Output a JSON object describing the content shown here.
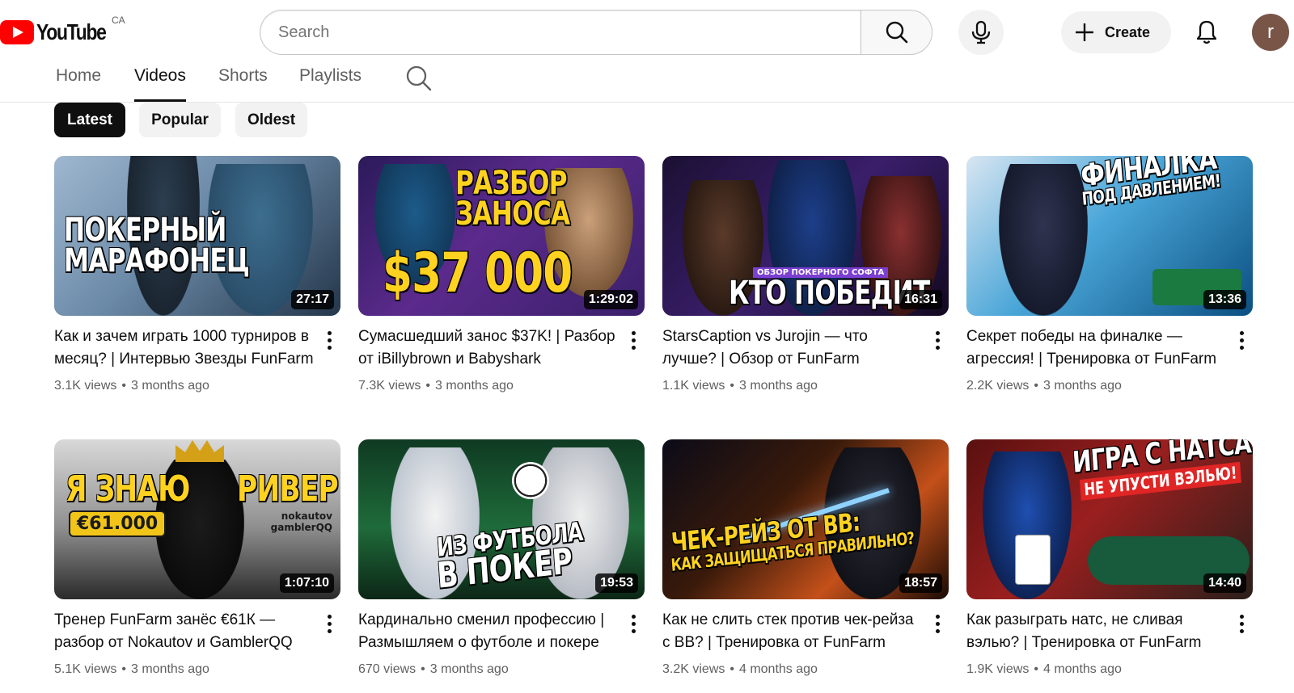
{
  "masthead": {
    "logo_text": "YouTube",
    "country_code": "CA",
    "search_placeholder": "Search",
    "create_label": "Create",
    "avatar_letter": "r",
    "avatar_color": "#795548"
  },
  "tabs": [
    {
      "label": "Home",
      "active": false
    },
    {
      "label": "Videos",
      "active": true
    },
    {
      "label": "Shorts",
      "active": false
    },
    {
      "label": "Playlists",
      "active": false
    }
  ],
  "chips": [
    {
      "label": "Latest",
      "active": true
    },
    {
      "label": "Popular",
      "active": false
    },
    {
      "label": "Oldest",
      "active": false
    }
  ],
  "videos": [
    {
      "title": "Как и зачем играть 1000 турниров в месяц? | Интервью Звезды FunFarm",
      "views": "3.1K views",
      "age": "3 months ago",
      "duration": "27:17",
      "thumb_text": [
        "ПОКЕРНЫЙ",
        "МАРАФОНЕЦ"
      ]
    },
    {
      "title": "Сумасшедший занос $37K! | Разбор от iBillybrown и Babyshark",
      "views": "7.3K views",
      "age": "3 months ago",
      "duration": "1:29:02",
      "thumb_text": [
        "РАЗБОР",
        "ЗАНОСА",
        "$37 000"
      ]
    },
    {
      "title": "StarsCaption vs Jurojin — что лучше? | Обзор от FunFarm",
      "views": "1.1K views",
      "age": "3 months ago",
      "duration": "16:31",
      "thumb_text": [
        "ОБЗОР ПОКЕРНОГО СОФТА",
        "КТО ПОБЕДИТ"
      ]
    },
    {
      "title": "Секрет победы на финалке — агрессия! | Тренировка от FunFarm",
      "views": "2.2K views",
      "age": "3 months ago",
      "duration": "13:36",
      "thumb_text": [
        "ФИНАЛКА",
        "ПОД ДАВЛЕНИЕМ!"
      ]
    },
    {
      "title": "Тренер FunFarm занёс €61К — разбор от Nokautov и GamblerQQ",
      "views": "5.1K views",
      "age": "3 months ago",
      "duration": "1:07:10",
      "thumb_text": [
        "Я ЗНАЮ",
        "РИВЕР",
        "€61.000",
        "nokautov",
        "gamblerQQ"
      ]
    },
    {
      "title": "Кардинально сменил профессию | Размышляем о футболе и покере",
      "views": "670 views",
      "age": "3 months ago",
      "duration": "19:53",
      "thumb_text": [
        "ИЗ ФУТБОЛА",
        "В ПОКЕР"
      ]
    },
    {
      "title": "Как не слить стек против чек-рейза с BB? | Тренировка от FunFarm",
      "views": "3.2K views",
      "age": "4 months ago",
      "duration": "18:57",
      "thumb_text": [
        "ЧЕК-РЕЙЗ ОТ BB:",
        "КАК ЗАЩИЩАТЬСЯ ПРАВИЛЬНО?"
      ]
    },
    {
      "title": "Как разыграть натс, не сливая вэлью? | Тренировка от FunFarm",
      "views": "1.9K views",
      "age": "4 months ago",
      "duration": "14:40",
      "thumb_text": [
        "ИГРА С НАТСАМИ:",
        "НЕ УПУСТИ ВЭЛЬЮ!"
      ]
    }
  ],
  "colors": {
    "brand_red": "#ff0000",
    "text_primary": "#0f0f0f",
    "text_secondary": "#606060",
    "chip_bg": "#f2f2f2",
    "chip_active_bg": "#0f0f0f"
  },
  "icons": [
    "youtube-logo-icon",
    "search-icon",
    "microphone-icon",
    "plus-icon",
    "bell-icon",
    "more-vertical-icon"
  ]
}
